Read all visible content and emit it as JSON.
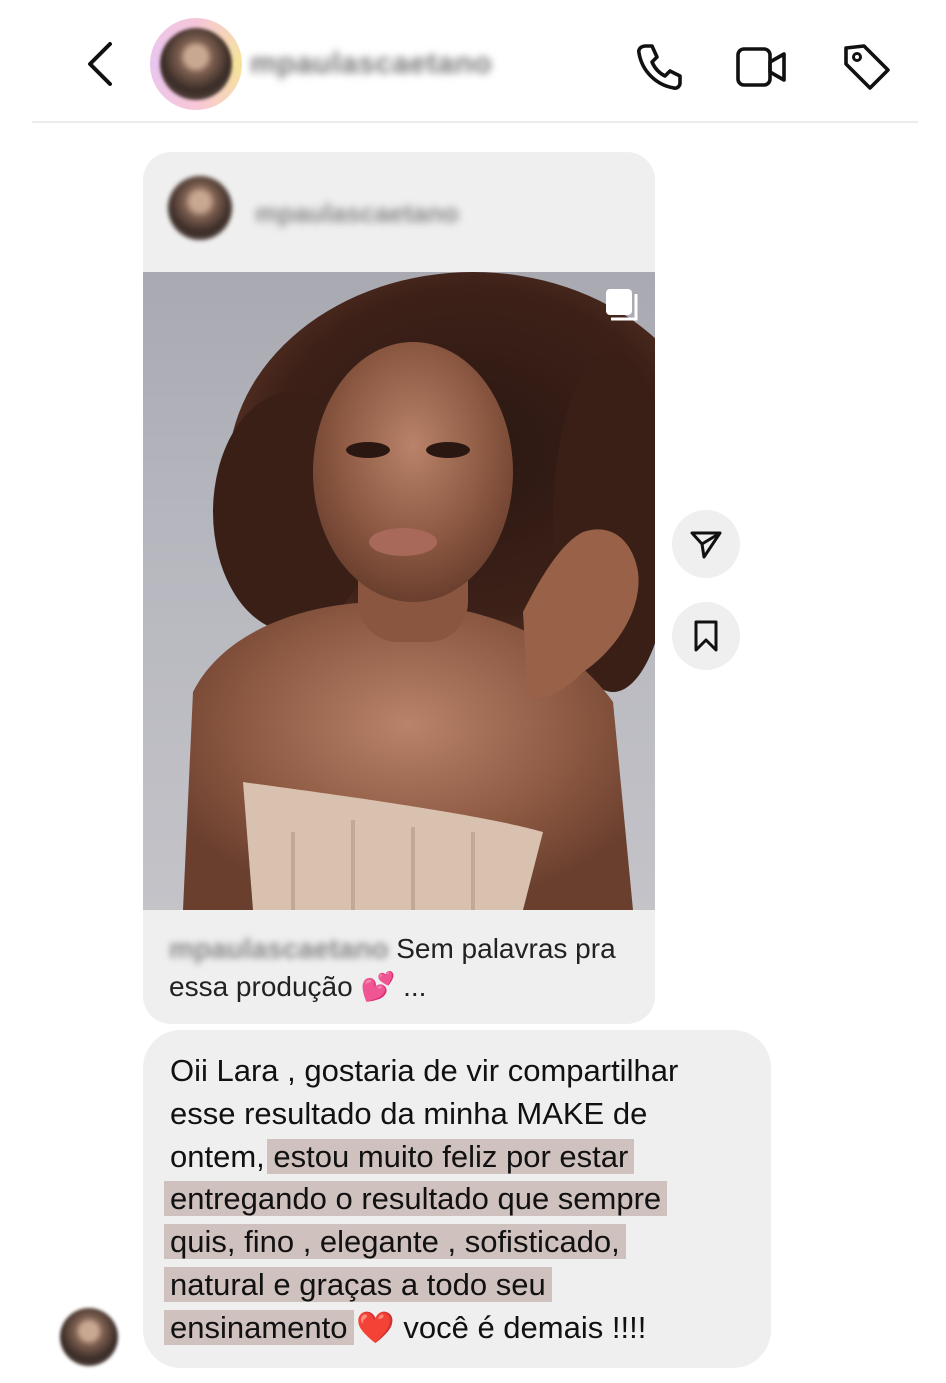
{
  "header": {
    "username": "mpaulascaetano",
    "icons": [
      "back-icon",
      "phone-icon",
      "video-icon",
      "tag-icon"
    ]
  },
  "shared_post": {
    "username": "mpaulascaetano",
    "caption_user": "mpaulascaetano",
    "caption_text": " Sem palavras pra essa produção",
    "caption_emoji": "💕",
    "caption_ellipsis": "...",
    "icons": [
      "multiple-posts-icon"
    ]
  },
  "side_actions": [
    "send-icon",
    "bookmark-icon"
  ],
  "message": {
    "line1": "Oii Lara , gostaria de vir compartilhar",
    "line2": "esse resultado da minha MAKE de",
    "line3_plain": "ontem, ",
    "line3_hl": "estou muito feliz por estar",
    "line4": "entregando o resultado que sempre",
    "line5": "quis, fino , elegante , sofisticado,",
    "line6": "natural e graças a todo seu",
    "line7_hl": "ensinamento",
    "line7_emoji": "❤️",
    "line7_plain": " você é demais !!!!"
  },
  "colors": {
    "bubble": "#efefef",
    "highlight": "#c7b3ae",
    "text": "#111111"
  }
}
